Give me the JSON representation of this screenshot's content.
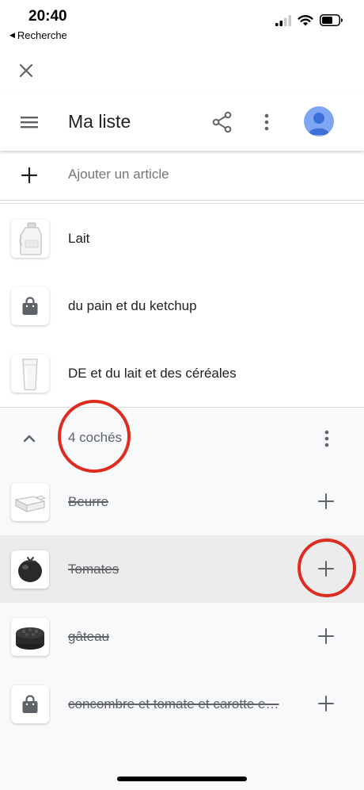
{
  "status_bar": {
    "time": "20:40",
    "back_label": "Recherche"
  },
  "header": {
    "title": "Ma liste"
  },
  "add_item": {
    "placeholder": "Ajouter un article"
  },
  "items": [
    {
      "label": "Lait",
      "icon": "milk-jug-icon"
    },
    {
      "label": "du pain et du ketchup",
      "icon": "shopping-bag-icon"
    },
    {
      "label": "DE et du lait et des céréales",
      "icon": "milk-glass-icon"
    }
  ],
  "checked_section": {
    "count_label": "4 cochés",
    "items": [
      {
        "label": "Beurre",
        "icon": "butter-icon"
      },
      {
        "label": "Tomates",
        "icon": "tomato-icon"
      },
      {
        "label": "gâteau",
        "icon": "cake-icon"
      },
      {
        "label": "concombre et tomate et carotte e…",
        "icon": "shopping-bag-icon"
      }
    ]
  },
  "colors": {
    "annotation_red": "#e02b20",
    "avatar_blue": "#7fa6f3",
    "avatar_dark": "#3d6fd9",
    "checked_bg": "#f8f9fa",
    "highlight_bg": "#ececec"
  }
}
